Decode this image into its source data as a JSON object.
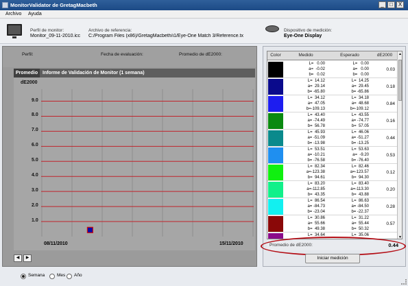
{
  "window": {
    "title": "MonitorValidator de GretagMacbeth",
    "minimize": "_",
    "maximize": "□",
    "close": "X"
  },
  "menu": {
    "archivo": "Archivo",
    "ayuda": "Ayuda"
  },
  "header": {
    "monitor_profile_label": "Perfil de monitor:",
    "monitor_profile_value": "Monitor_09-11-2010.icc",
    "reference_file_label": "Archivo de referencia:",
    "reference_file_value": "C:/Program Files (x86)/GretagMacbeth/i1/Eye-One Match 3/Reference.tx",
    "device_label": "Dispositivo de medición:",
    "device_value": "Eye-One Display"
  },
  "info": {
    "perfil": "Perfil:",
    "fecha": "Fecha de evaluación:",
    "promedio": "Promedio de dE2000:"
  },
  "chart_tab": "Promedio",
  "chart_title": "Informe de Validación de Monitor (1 semana)",
  "chart_data": {
    "type": "scatter",
    "ylabel": "dE2000",
    "y_ticks": [
      "9.0",
      "8.0",
      "7.0",
      "6.0",
      "5.0",
      "4.0",
      "3.0",
      "2.0",
      "1.0"
    ],
    "ylim": [
      0,
      9.8
    ],
    "x_start_label": "08/11/2010",
    "x_end_label": "15/11/2010",
    "x_divisions": 7,
    "points": [
      {
        "day_index": 1.6,
        "value": 0.44
      }
    ],
    "grid": true
  },
  "nav": {
    "prev": "◀",
    "next": "▶"
  },
  "table": {
    "headers": {
      "color": "Color",
      "medido": "Medido",
      "esperado": "Esperado",
      "de": "dE2000"
    },
    "rows": [
      {
        "color": "#000000",
        "medido": "L=   0.00\na=  -0.02\nb=   0.02",
        "esperado": "L=   0.00\na=   0.00\nb=   0.00",
        "de": "0.03"
      },
      {
        "color": "#0a0a8c",
        "medido": "L=  14.12\na=  29.14\nb= -65.80",
        "esperado": "L=  14.25\na=  29.45\nb= -65.86",
        "de": "0.18"
      },
      {
        "color": "#1d1df0",
        "medido": "L=  34.12\na=  47.05\nb=-109.13",
        "esperado": "L=  34.18\na=  48.68\nb=-109.12",
        "de": "0.84"
      },
      {
        "color": "#0a8a10",
        "medido": "L=  43.40\na= -74.49\nb=  56.78",
        "esperado": "L=  43.55\na= -74.77\nb=  57.05",
        "de": "0.16"
      },
      {
        "color": "#0a8a8c",
        "medido": "L=  45.93\na= -51.09\nb= -13.98",
        "esperado": "L=  46.06\na= -51.27\nb= -13.25",
        "de": "0.44"
      },
      {
        "color": "#1f8ff0",
        "medido": "L=  53.51\na= -10.21\nb= -76.58",
        "esperado": "L=  53.63\na=  -9.20\nb= -76.40",
        "de": "0.53"
      },
      {
        "color": "#10f010",
        "medido": "L=  82.34\na=-123.38\nb=  94.61",
        "esperado": "L=  82.46\na=-123.57\nb=  94.30",
        "de": "0.12"
      },
      {
        "color": "#12f08a",
        "medido": "L=  83.20\na=-112.85\nb=  43.35",
        "esperado": "L=  83.40\na=-113.30\nb=  43.88",
        "de": "0.20"
      },
      {
        "color": "#12f0f0",
        "medido": "L=  86.54\na= -84.73\nb= -23.04",
        "esperado": "L=  86.63\na= -84.50\nb= -22.37",
        "de": "0.28"
      },
      {
        "color": "#8a0808",
        "medido": "L=  30.86\na=  55.66\nb=  49.38",
        "esperado": "L=  31.22\na=  55.44\nb=  50.32",
        "de": "0.57"
      },
      {
        "color": "#8a0a8a",
        "medido": "L=  34.64",
        "esperado": "L=  35.06",
        "de": ""
      }
    ]
  },
  "average": {
    "label": "Promedio de dE2000:",
    "value": "0.44"
  },
  "start_button": "Iniciar medición",
  "period": {
    "semana": "Semana",
    "mes": "Mes",
    "ano": "Año",
    "selected": "Semana"
  },
  "colors": {
    "grid_line": "#c0242c",
    "point_fill": "#0a0aa8",
    "point_border": "#d01010",
    "highlight": "#b30c14"
  }
}
